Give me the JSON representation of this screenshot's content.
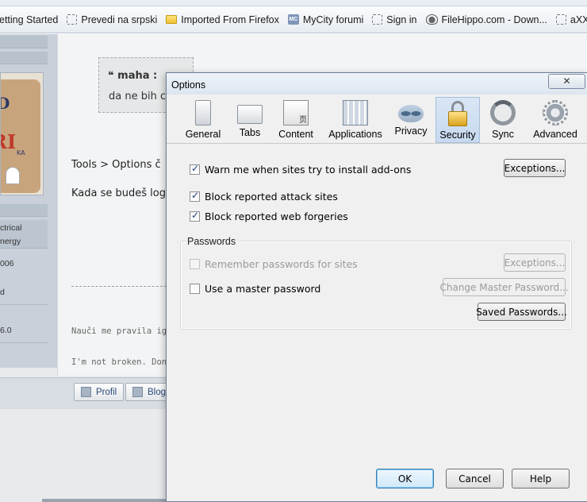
{
  "bookmarks": [
    {
      "label": "etting Started",
      "icon": "dashed-page-icon"
    },
    {
      "label": "Prevedi na srpski",
      "icon": "dashed-page-icon"
    },
    {
      "label": "Imported From Firefox",
      "icon": "folder-icon"
    },
    {
      "label": "MyCity forumi",
      "icon": "mycity-favicon-icon"
    },
    {
      "label": "Sign in",
      "icon": "dashed-page-icon"
    },
    {
      "label": "FileHippo.com - Down...",
      "icon": "filehippo-favicon-icon"
    },
    {
      "label": "aXXo Movie",
      "icon": "dashed-page-icon"
    }
  ],
  "forum": {
    "mc_icon_text": "MC",
    "quote_author": "maha :",
    "quote_text": "da ne bih c",
    "post_line1": "Tools > Options č",
    "post_line2": "Kada se budeš log",
    "left_fields": [
      "ctrical",
      "nergy",
      "006",
      "d",
      "6.0"
    ],
    "signature1": "Nauči me pravila igre",
    "signature2": "I'm not broken. Don'",
    "profile_button": "Profil",
    "blog_button": "Blog"
  },
  "dialog": {
    "title": "Options",
    "close_glyph": "✕",
    "panes": [
      {
        "label": "General",
        "icon": "general-pane-icon"
      },
      {
        "label": "Tabs",
        "icon": "tabs-pane-icon"
      },
      {
        "label": "Content",
        "icon": "content-pane-icon"
      },
      {
        "label": "Applications",
        "icon": "applications-pane-icon"
      },
      {
        "label": "Privacy",
        "icon": "privacy-mask-icon"
      },
      {
        "label": "Security",
        "icon": "padlock-icon",
        "selected": true
      },
      {
        "label": "Sync",
        "icon": "sync-icon"
      },
      {
        "label": "Advanced",
        "icon": "gear-icon"
      }
    ],
    "content_icon_text": "页",
    "security": {
      "warn_addons": {
        "label": "Warn me when sites try to install add-ons",
        "checked": true
      },
      "exceptions_1": "Exceptions...",
      "block_attack": {
        "label": "Block reported attack sites",
        "checked": true
      },
      "block_forgeries": {
        "label": "Block reported web forgeries",
        "checked": true
      },
      "passwords_caption": "Passwords",
      "remember_passwords": {
        "label": "Remember passwords for sites",
        "checked": false,
        "disabled": true
      },
      "exceptions_2": "Exceptions...",
      "master_password": {
        "label": "Use a master password",
        "checked": false
      },
      "change_master_button": "Change Master Password...",
      "saved_passwords_button": "Saved Passwords..."
    },
    "buttons": {
      "ok": "OK",
      "cancel": "Cancel",
      "help": "Help"
    }
  }
}
